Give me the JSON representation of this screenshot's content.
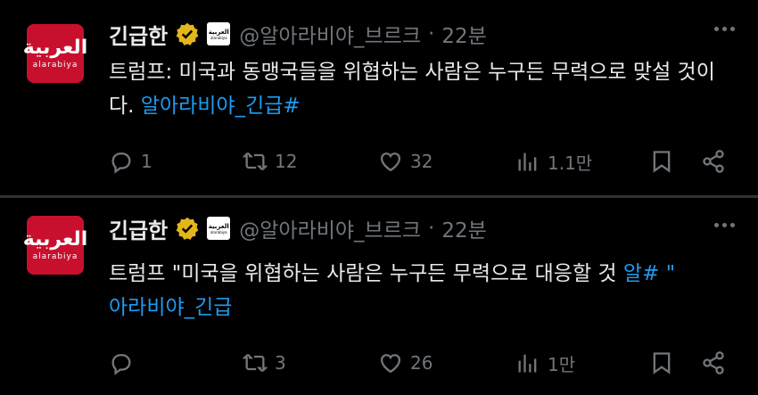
{
  "tweets": [
    {
      "avatar": {
        "arabic": "العربية",
        "latin": "alarabiya"
      },
      "name": "긴급한",
      "affiliate": {
        "arabic": "العربية",
        "latin": "alarabiya"
      },
      "handle": "@알아라비야_브르크",
      "separator": "·",
      "time": "22분",
      "text": "트럼프: 미국과 동맹국들을 위협하는 사람은 누구든 무력으로 맞설 것이다. ",
      "hashtag": "알아라비야_긴급#",
      "replies": "1",
      "retweets": "12",
      "likes": "32",
      "views": "1.1만"
    },
    {
      "avatar": {
        "arabic": "العربية",
        "latin": "alarabiya"
      },
      "name": "긴급한",
      "affiliate": {
        "arabic": "العربية",
        "latin": "alarabiya"
      },
      "handle": "@알아라비야_브르크",
      "separator": "·",
      "time": "22분",
      "text": "트럼프 \"미국을 위협하는 사람은 누구든 무력으로 대응할 것 ",
      "hashtag": "알# \"",
      "hashtag2": "아라비야_긴급",
      "replies": "",
      "retweets": "3",
      "likes": "26",
      "views": "1만"
    }
  ],
  "colors": {
    "background": "#000000",
    "text": "#e7e9ea",
    "muted": "#71767b",
    "link": "#1d9bf0",
    "verified": "#e2b719",
    "avatar": "#c8102e"
  }
}
